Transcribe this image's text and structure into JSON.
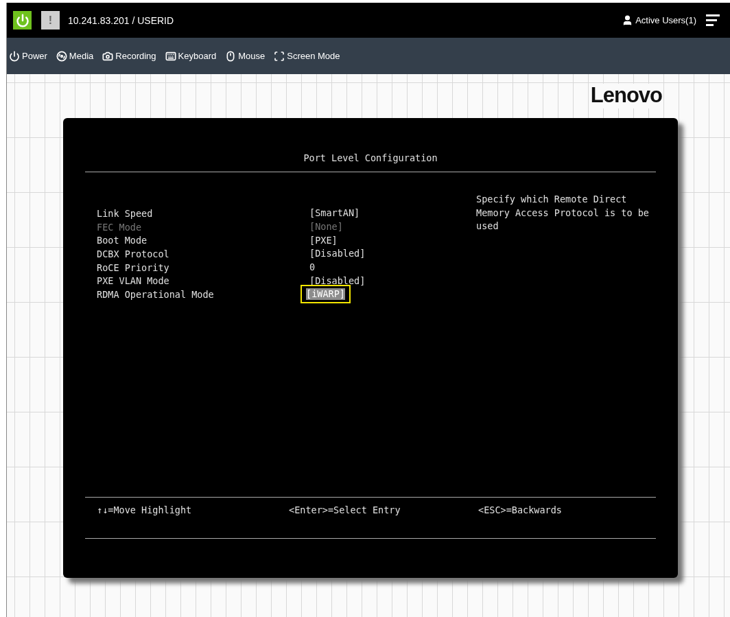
{
  "top_bar": {
    "alert_label": "!",
    "address": "10.241.83.201 / USERID",
    "active_users": "Active Users(1)"
  },
  "toolbar": [
    {
      "kind": "power",
      "label": "Power"
    },
    {
      "kind": "media",
      "label": "Media"
    },
    {
      "kind": "recording",
      "label": "Recording"
    },
    {
      "kind": "keyboard",
      "label": "Keyboard"
    },
    {
      "kind": "mouse",
      "label": "Mouse"
    },
    {
      "kind": "screen",
      "label": "Screen Mode"
    }
  ],
  "logo": "Lenovo",
  "console": {
    "title": "Port Level Configuration",
    "settings": [
      {
        "label": "Link Speed",
        "value": "[SmartAN]",
        "disabled": false,
        "selected": false
      },
      {
        "label": "FEC Mode",
        "value": "[None]",
        "disabled": true,
        "selected": false
      },
      {
        "label": "Boot Mode",
        "value": "[PXE]",
        "disabled": false,
        "selected": false
      },
      {
        "label": "DCBX Protocol",
        "value": "[Disabled]",
        "disabled": false,
        "selected": false
      },
      {
        "label": "RoCE Priority",
        "value": "0",
        "disabled": false,
        "selected": false
      },
      {
        "label": "PXE VLAN Mode",
        "value": "[Disabled]",
        "disabled": false,
        "selected": false
      },
      {
        "label": "RDMA Operational Mode",
        "value": "[iWARP]",
        "disabled": false,
        "selected": true
      }
    ],
    "help": "Specify which Remote Direct Memory Access Protocol is to be used",
    "footer": [
      "↑↓=Move Highlight",
      "<Enter>=Select Entry",
      "<ESC>=Backwards"
    ]
  }
}
